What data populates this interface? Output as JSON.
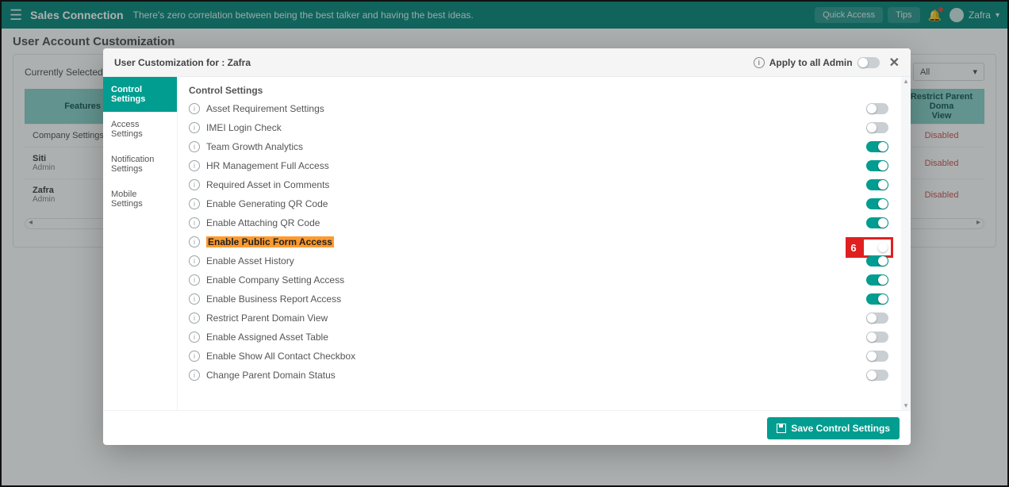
{
  "topbar": {
    "brand": "Sales Connection",
    "tagline": "There's zero correlation between being the best talker and having the best ideas.",
    "quick_access": "Quick Access",
    "tips": "Tips",
    "username": "Zafra"
  },
  "page": {
    "title": "User Account Customization"
  },
  "dep_bar": {
    "label": "Currently Selected Dep",
    "select_value": "All"
  },
  "table": {
    "headers": [
      "Features",
      "Restrict Parent Doma\nView"
    ],
    "company_row": "Company Settings",
    "rows": [
      {
        "name": "Siti",
        "sub": "Admin",
        "value": "Disabled"
      },
      {
        "name": "Zafra",
        "sub": "Admin",
        "value": "Disabled"
      }
    ],
    "extra_disabled": "Disabled"
  },
  "modal": {
    "title": "User Customization for : Zafra",
    "apply_label": "Apply to all Admin",
    "side_tabs": [
      "Control Settings",
      "Access Settings",
      "Notification Settings",
      "Mobile Settings"
    ],
    "content_title": "Control Settings",
    "settings": [
      {
        "label": "Asset Requirement Settings",
        "on": false
      },
      {
        "label": "IMEI Login Check",
        "on": false
      },
      {
        "label": "Team Growth Analytics",
        "on": true
      },
      {
        "label": "HR Management Full Access",
        "on": true
      },
      {
        "label": "Required Asset in Comments",
        "on": true
      },
      {
        "label": "Enable Generating QR Code",
        "on": true
      },
      {
        "label": "Enable Attaching QR Code",
        "on": true
      },
      {
        "label": "Enable Public Form Access",
        "on": true,
        "highlight": true,
        "annot": "6"
      },
      {
        "label": "Enable Asset History",
        "on": true
      },
      {
        "label": "Enable Company Setting Access",
        "on": true
      },
      {
        "label": "Enable Business Report Access",
        "on": true
      },
      {
        "label": "Restrict Parent Domain View",
        "on": false
      },
      {
        "label": "Enable Assigned Asset Table",
        "on": false
      },
      {
        "label": "Enable Show All Contact Checkbox",
        "on": false
      },
      {
        "label": "Change Parent Domain Status",
        "on": false
      }
    ],
    "save_label": "Save Control Settings"
  }
}
